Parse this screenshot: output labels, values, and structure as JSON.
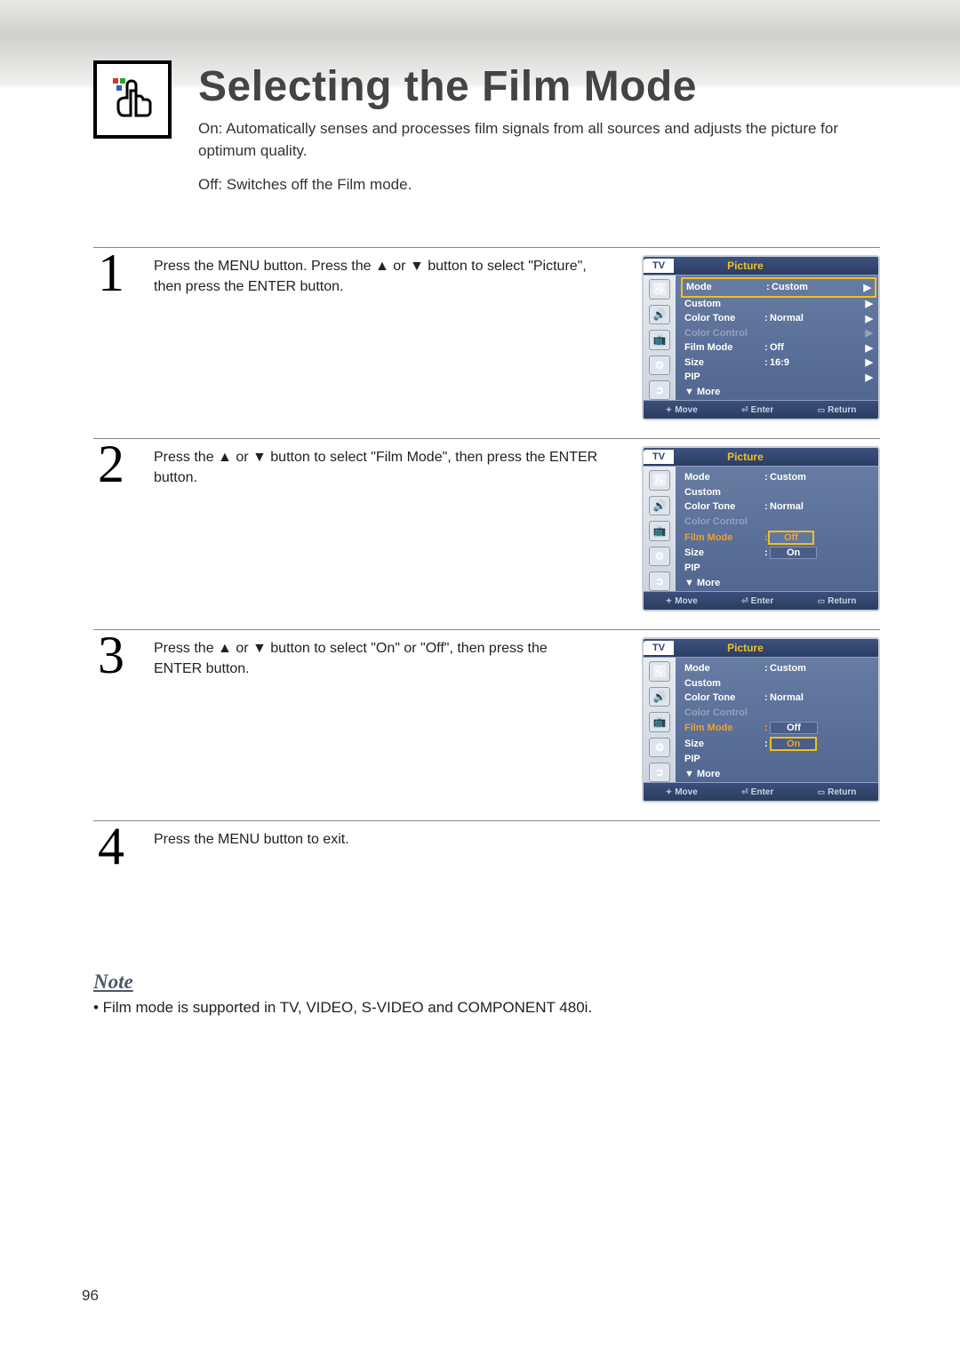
{
  "title": "Selecting the Film Mode",
  "intro_on": "On: Automatically senses and processes film signals from all sources and adjusts the picture for optimum quality.",
  "intro_off": "Off: Switches off the Film mode.",
  "steps": {
    "s1": {
      "num": "1",
      "text": "Press the MENU button. Press the ▲ or ▼ button to select \"Picture\", then press the ENTER button."
    },
    "s2": {
      "num": "2",
      "text": "Press the ▲ or ▼ button to select \"Film Mode\", then press the ENTER button."
    },
    "s3": {
      "num": "3",
      "text": "Press the ▲ or ▼ button to select \"On\" or \"Off\", then press the ENTER button."
    },
    "s4": {
      "num": "4",
      "text": "Press the MENU button to exit."
    }
  },
  "note": {
    "heading": "Note",
    "text": "•  Film mode is supported in TV, VIDEO, S-VIDEO and COMPONENT 480i."
  },
  "page_num": "96",
  "osd": {
    "header": {
      "tv": "TV",
      "title": "Picture"
    },
    "labels": {
      "mode": "Mode",
      "custom": "Custom",
      "color_tone": "Color Tone",
      "color_control": "Color Control",
      "film_mode": "Film Mode",
      "size": "Size",
      "pip": "PIP",
      "more": "▼ More"
    },
    "values": {
      "mode": "Custom",
      "color_tone": "Normal",
      "film_mode_off": "Off",
      "film_mode_on": "On",
      "size": "16:9"
    },
    "footer": {
      "move": "Move",
      "enter": "Enter",
      "return": "Return"
    }
  }
}
